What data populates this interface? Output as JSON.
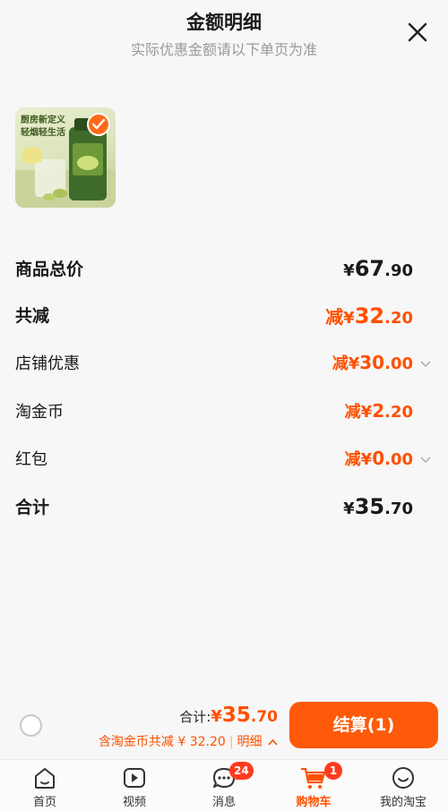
{
  "header": {
    "title": "金额明细",
    "subtitle": "实际优惠金额请以下单页为准"
  },
  "product": {
    "image_caption_line1": "厨房新定义",
    "image_caption_line2": "轻烟轻生活"
  },
  "rows": [
    {
      "label": "商品总价",
      "prefix": "",
      "yen": "¥",
      "int": "67",
      "dec": ".90"
    },
    {
      "label": "共减",
      "prefix": "减",
      "yen": "¥",
      "int": "32",
      "dec": ".20"
    },
    {
      "label": "店铺优惠",
      "prefix": "减",
      "yen": "¥",
      "int": "30",
      "dec": ".00"
    },
    {
      "label": "淘金币",
      "prefix": "减",
      "yen": "¥",
      "int": "2",
      "dec": ".20"
    },
    {
      "label": "红包",
      "prefix": "减",
      "yen": "¥",
      "int": "0",
      "dec": ".00"
    },
    {
      "label": "合计",
      "prefix": "",
      "yen": "¥",
      "int": "35",
      "dec": ".70"
    }
  ],
  "footer": {
    "total_label": "合计:",
    "total_yen": "¥",
    "total_int": "35",
    "total_dec": ".70",
    "discount_text": "含淘金币共减 ¥ 32.20",
    "separator": "|",
    "detail_link": "明细",
    "checkout_label": "结算(1)"
  },
  "tabbar": {
    "home": "首页",
    "video": "视频",
    "messages": "消息",
    "messages_badge": "24",
    "cart": "购物车",
    "cart_badge": "1",
    "mine": "我的淘宝"
  },
  "colors": {
    "accent": "#ff5000",
    "checkout_bg": "#ff5a0a",
    "badge": "#ff3b1f"
  }
}
